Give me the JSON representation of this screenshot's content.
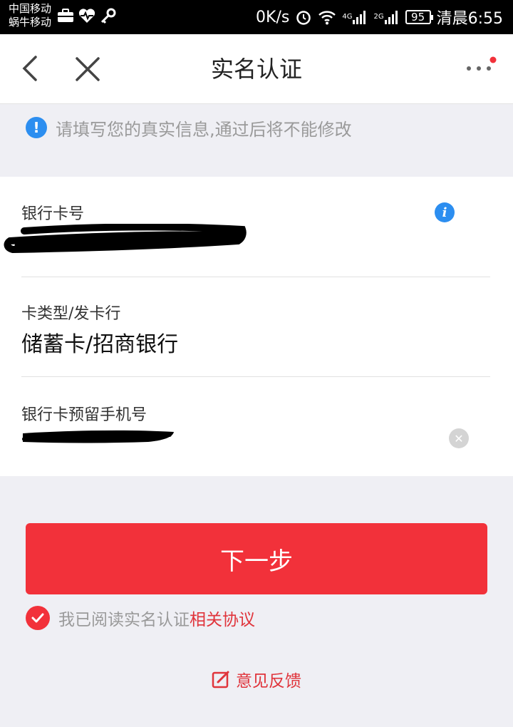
{
  "status_bar": {
    "carrier_line1": "中国移动",
    "carrier_line2": "蜗牛移动",
    "speed": "0K/s",
    "sig1_label": "4G",
    "sig2_label": "2G",
    "battery": "95",
    "time": "清晨6:55"
  },
  "nav": {
    "title": "实名认证",
    "back_icon": "back-arrow-icon",
    "close_icon": "close-icon",
    "more_icon": "more-dots-icon"
  },
  "notice": {
    "text": "请填写您的真实信息,通过后将不能修改"
  },
  "form": {
    "card_number_label": "银行卡号",
    "card_type_label": "卡类型/发卡行",
    "card_type_value": "储蓄卡/招商银行",
    "phone_label": "银行卡预留手机号"
  },
  "actions": {
    "next_label": "下一步",
    "agree_text": "我已阅读实名认证",
    "agree_link": "相关协议",
    "feedback_label": "意见反馈"
  },
  "colors": {
    "accent": "#f2313a",
    "info_blue": "#2c8ef0"
  }
}
